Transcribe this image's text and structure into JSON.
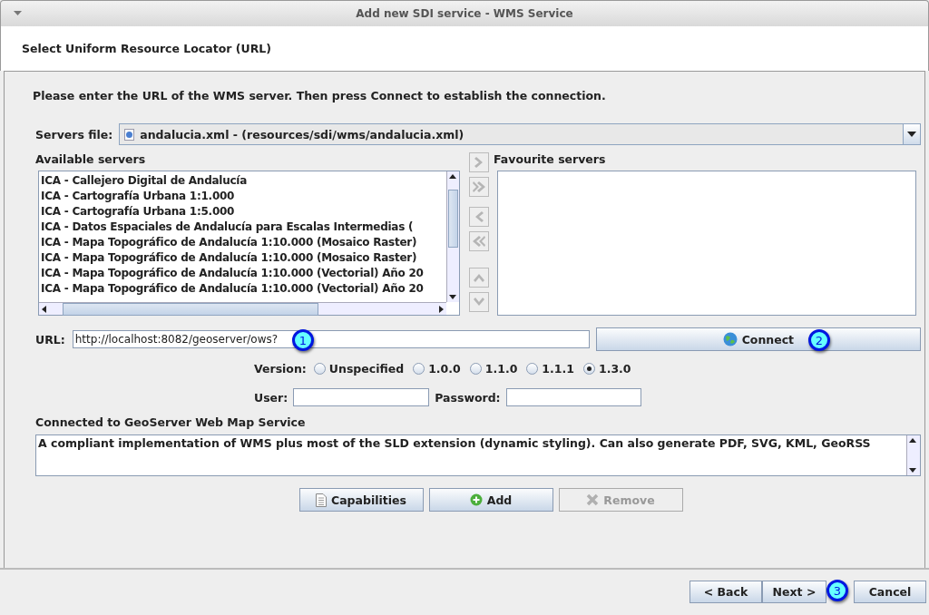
{
  "window": {
    "title": "Add new SDI service - WMS Service"
  },
  "header": {
    "title": "Select Uniform Resource Locator (URL)"
  },
  "instruction": "Please enter the URL of the WMS server. Then press Connect to establish the connection.",
  "servers_file": {
    "label": "Servers file:",
    "value": "andalucia.xml - (resources/sdi/wms/andalucia.xml)"
  },
  "available_servers": {
    "label": "Available servers",
    "items": [
      "ICA - Callejero Digital de Andalucía",
      "ICA - Cartografía Urbana 1:1.000",
      "ICA - Cartografía Urbana 1:5.000",
      "ICA - Datos Espaciales de Andalucía para Escalas Intermedias (",
      "ICA - Mapa Topográfico de Andalucía 1:10.000 (Mosaico Raster)",
      "ICA - Mapa Topográfico de Andalucía 1:10.000 (Mosaico Raster)",
      "ICA - Mapa Topográfico de Andalucía 1:10.000 (Vectorial) Año 20",
      "ICA - Mapa Topográfico de Andalucía 1:10.000 (Vectorial) Año 20"
    ]
  },
  "transfer_buttons": [
    {
      "kind": "right",
      "disabled": true
    },
    {
      "kind": "all-right",
      "disabled": true
    },
    {
      "kind": "left",
      "disabled": true
    },
    {
      "kind": "all-left",
      "disabled": true
    },
    {
      "kind": "up",
      "disabled": true
    },
    {
      "kind": "down",
      "disabled": true
    }
  ],
  "favourite_servers": {
    "label": "Favourite servers"
  },
  "url": {
    "label": "URL:",
    "value": "http://localhost:8082/geoserver/ows?"
  },
  "connect": {
    "label": "Connect"
  },
  "version": {
    "label": "Version:",
    "options": [
      {
        "label": "Unspecified",
        "selected": false
      },
      {
        "label": "1.0.0",
        "selected": false
      },
      {
        "label": "1.1.0",
        "selected": false
      },
      {
        "label": "1.1.1",
        "selected": false
      },
      {
        "label": "1.3.0",
        "selected": true
      }
    ]
  },
  "user": {
    "label": "User:"
  },
  "password": {
    "label": "Password:"
  },
  "description": {
    "label": "Connected to GeoServer Web Map Service",
    "text": "A compliant implementation of WMS plus most of the SLD extension (dynamic styling). Can also generate PDF, SVG, KML, GeoRSS"
  },
  "actions": [
    {
      "label": "Capabilities",
      "kind": "document",
      "disabled": false
    },
    {
      "label": "Add",
      "kind": "add",
      "disabled": false
    },
    {
      "label": "Remove",
      "kind": "remove",
      "disabled": true
    }
  ],
  "footer_buttons": [
    {
      "label": "< Back"
    },
    {
      "label": "Next >"
    },
    {
      "label": "Cancel"
    }
  ],
  "callouts": [
    {
      "label": "1"
    },
    {
      "label": "2"
    },
    {
      "label": "3"
    }
  ]
}
